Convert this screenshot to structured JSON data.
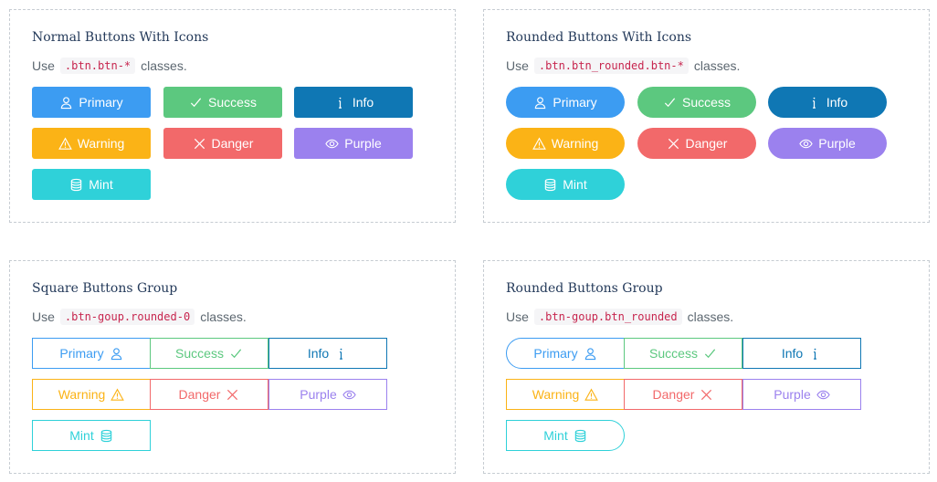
{
  "panels": [
    {
      "title": "Normal Buttons With Icons",
      "desc_pre": "Use",
      "code": ".btn.btn-*",
      "desc_post": "classes."
    },
    {
      "title": "Rounded Buttons With Icons",
      "desc_pre": "Use",
      "code": ".btn.btn_rounded.btn-*",
      "desc_post": "classes."
    },
    {
      "title": "Square Buttons Group",
      "desc_pre": "Use",
      "code": ".btn-goup.rounded-0",
      "desc_post": "classes."
    },
    {
      "title": "Rounded Buttons Group",
      "desc_pre": "Use",
      "code": ".btn-goup.btn_rounded",
      "desc_post": "classes."
    }
  ],
  "buttons": {
    "primary": "Primary",
    "success": "Success",
    "info": "Info",
    "warning": "Warning",
    "danger": "Danger",
    "purple": "Purple",
    "mint": "Mint"
  },
  "icons": {
    "primary": "user-icon",
    "success": "check-icon",
    "info": "info-icon",
    "warning": "warning-triangle-icon",
    "danger": "close-icon",
    "purple": "eye-icon",
    "mint": "database-icon"
  },
  "colors": {
    "primary": "#3c9cf2",
    "success": "#5cc87f",
    "info": "#0f77b4",
    "warning": "#fbb316",
    "danger": "#f2696a",
    "purple": "#9b81ee",
    "mint": "#2fd1d9"
  }
}
